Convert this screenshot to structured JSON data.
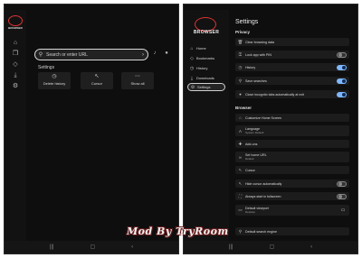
{
  "left_screen": {
    "logo_text": "BROWSER",
    "search": {
      "placeholder": "Search or enter URL"
    },
    "settings_header": "Settings",
    "quick_actions": [
      {
        "icon": "clock-icon",
        "label": "Delete history"
      },
      {
        "icon": "cursor-icon",
        "label": "Cursor"
      },
      {
        "icon": "more-icon",
        "label": "Show all"
      }
    ]
  },
  "right_screen": {
    "logo_text": "BROWSER",
    "nav": [
      {
        "icon": "home-icon",
        "label": "Home"
      },
      {
        "icon": "bookmark-icon",
        "label": "Bookmarks"
      },
      {
        "icon": "history-icon",
        "label": "History"
      },
      {
        "icon": "download-icon",
        "label": "Downloads"
      },
      {
        "icon": "gear-icon",
        "label": "Settings",
        "selected": true
      }
    ],
    "title": "Settings",
    "privacy_header": "Privacy",
    "privacy_rows": [
      {
        "label": "Clear browsing data"
      },
      {
        "label": "Lock app with PIN",
        "toggle": "off"
      },
      {
        "label": "History",
        "toggle": "on"
      },
      {
        "label": "Save searches",
        "toggle": "on"
      },
      {
        "label": "Close incognito tabs automatically at exit",
        "toggle": "on"
      }
    ],
    "browser_header": "Browser",
    "browser_rows": [
      {
        "label": "Customize Home Screen"
      },
      {
        "label": "Language",
        "sub": "System Default"
      },
      {
        "label": "Add-ons"
      },
      {
        "label": "Set home URL",
        "sub": "Default"
      },
      {
        "label": "Cursor"
      },
      {
        "label": "Hide cursor automatically",
        "toggle": "off"
      },
      {
        "label": "Always start in fullscreen",
        "toggle": "off"
      },
      {
        "label": "Default viewport",
        "sub": "Desktop"
      },
      {
        "label": "Default search engine"
      }
    ]
  },
  "watermark": "Mod By TryRoom"
}
